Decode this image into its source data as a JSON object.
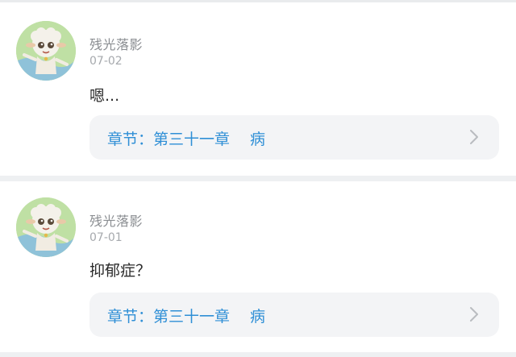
{
  "comments": [
    {
      "user": "残光落影",
      "date": "07-02",
      "message": "嗯...",
      "chapter_label": "章节：第三十一章　 病",
      "avatar_icon": "sheep-avatar-icon",
      "chevron_icon": "chevron-right-icon"
    },
    {
      "user": "残光落影",
      "date": "07-01",
      "message": "抑郁症？",
      "chapter_label": "章节：第三十一章　 病",
      "avatar_icon": "sheep-avatar-icon",
      "chevron_icon": "chevron-right-icon"
    }
  ],
  "colors": {
    "chapter_text": "#2f8fd6",
    "username": "#8a8d91",
    "date": "#a6a9ad",
    "message": "#2b2b2b",
    "chapter_bg": "#f3f4f6",
    "page_bg": "#eef0f2"
  }
}
